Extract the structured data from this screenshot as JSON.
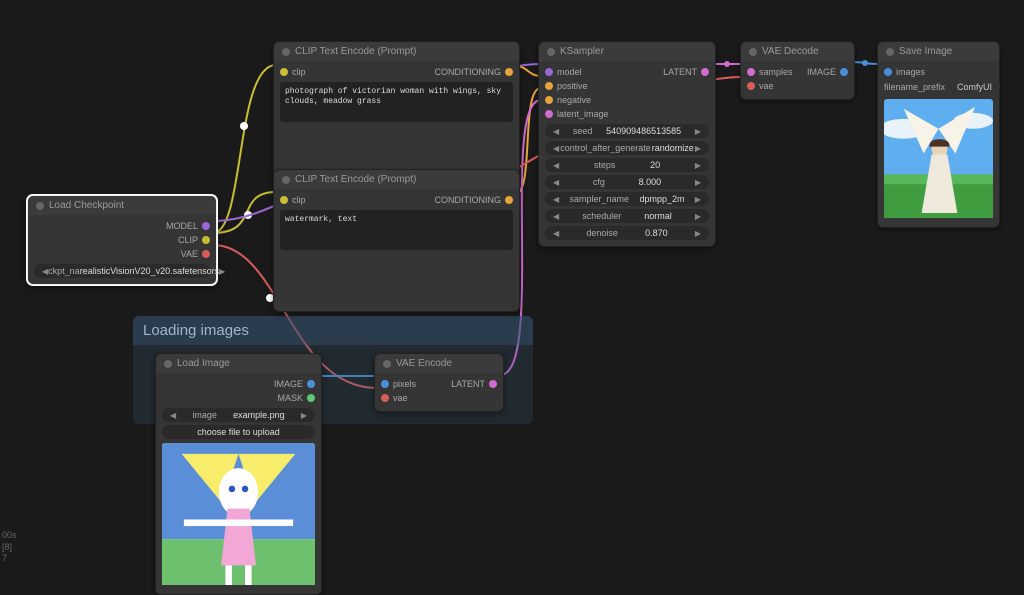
{
  "status": {
    "line1": "00s",
    "line2": "[8]",
    "line3": "7"
  },
  "group": {
    "title": "Loading images"
  },
  "load_checkpoint": {
    "title": "Load Checkpoint",
    "out_model": "MODEL",
    "out_clip": "CLIP",
    "out_vae": "VAE",
    "ckpt_label": "ckpt_na",
    "ckpt_value": "realisticVisionV20_v20.safetensors"
  },
  "clip_pos": {
    "title": "CLIP Text Encode (Prompt)",
    "in_clip": "clip",
    "out_cond": "CONDITIONING",
    "text": "photograph of victorian woman with wings, sky clouds, meadow grass"
  },
  "clip_neg": {
    "title": "CLIP Text Encode (Prompt)",
    "in_clip": "clip",
    "out_cond": "CONDITIONING",
    "text": "watermark, text"
  },
  "load_image": {
    "title": "Load Image",
    "out_image": "IMAGE",
    "out_mask": "MASK",
    "image_label": "image",
    "image_value": "example.png",
    "button": "choose file to upload"
  },
  "vae_encode": {
    "title": "VAE Encode",
    "in_pixels": "pixels",
    "in_vae": "vae",
    "out_latent": "LATENT"
  },
  "ksampler": {
    "title": "KSampler",
    "in_model": "model",
    "in_positive": "positive",
    "in_negative": "negative",
    "in_latent": "latent_image",
    "out_latent": "LATENT",
    "seed_label": "seed",
    "seed_value": "540909486513585",
    "cag_label": "control_after_generate",
    "cag_value": "randomize",
    "steps_label": "steps",
    "steps_value": "20",
    "cfg_label": "cfg",
    "cfg_value": "8.000",
    "sampler_label": "sampler_name",
    "sampler_value": "dpmpp_2m",
    "scheduler_label": "scheduler",
    "scheduler_value": "normal",
    "denoise_label": "denoise",
    "denoise_value": "0.870"
  },
  "vae_decode": {
    "title": "VAE Decode",
    "in_samples": "samples",
    "in_vae": "vae",
    "out_image": "IMAGE"
  },
  "save_image": {
    "title": "Save Image",
    "in_images": "images",
    "prefix_label": "filename_prefix",
    "prefix_value": "ComfyUI"
  }
}
